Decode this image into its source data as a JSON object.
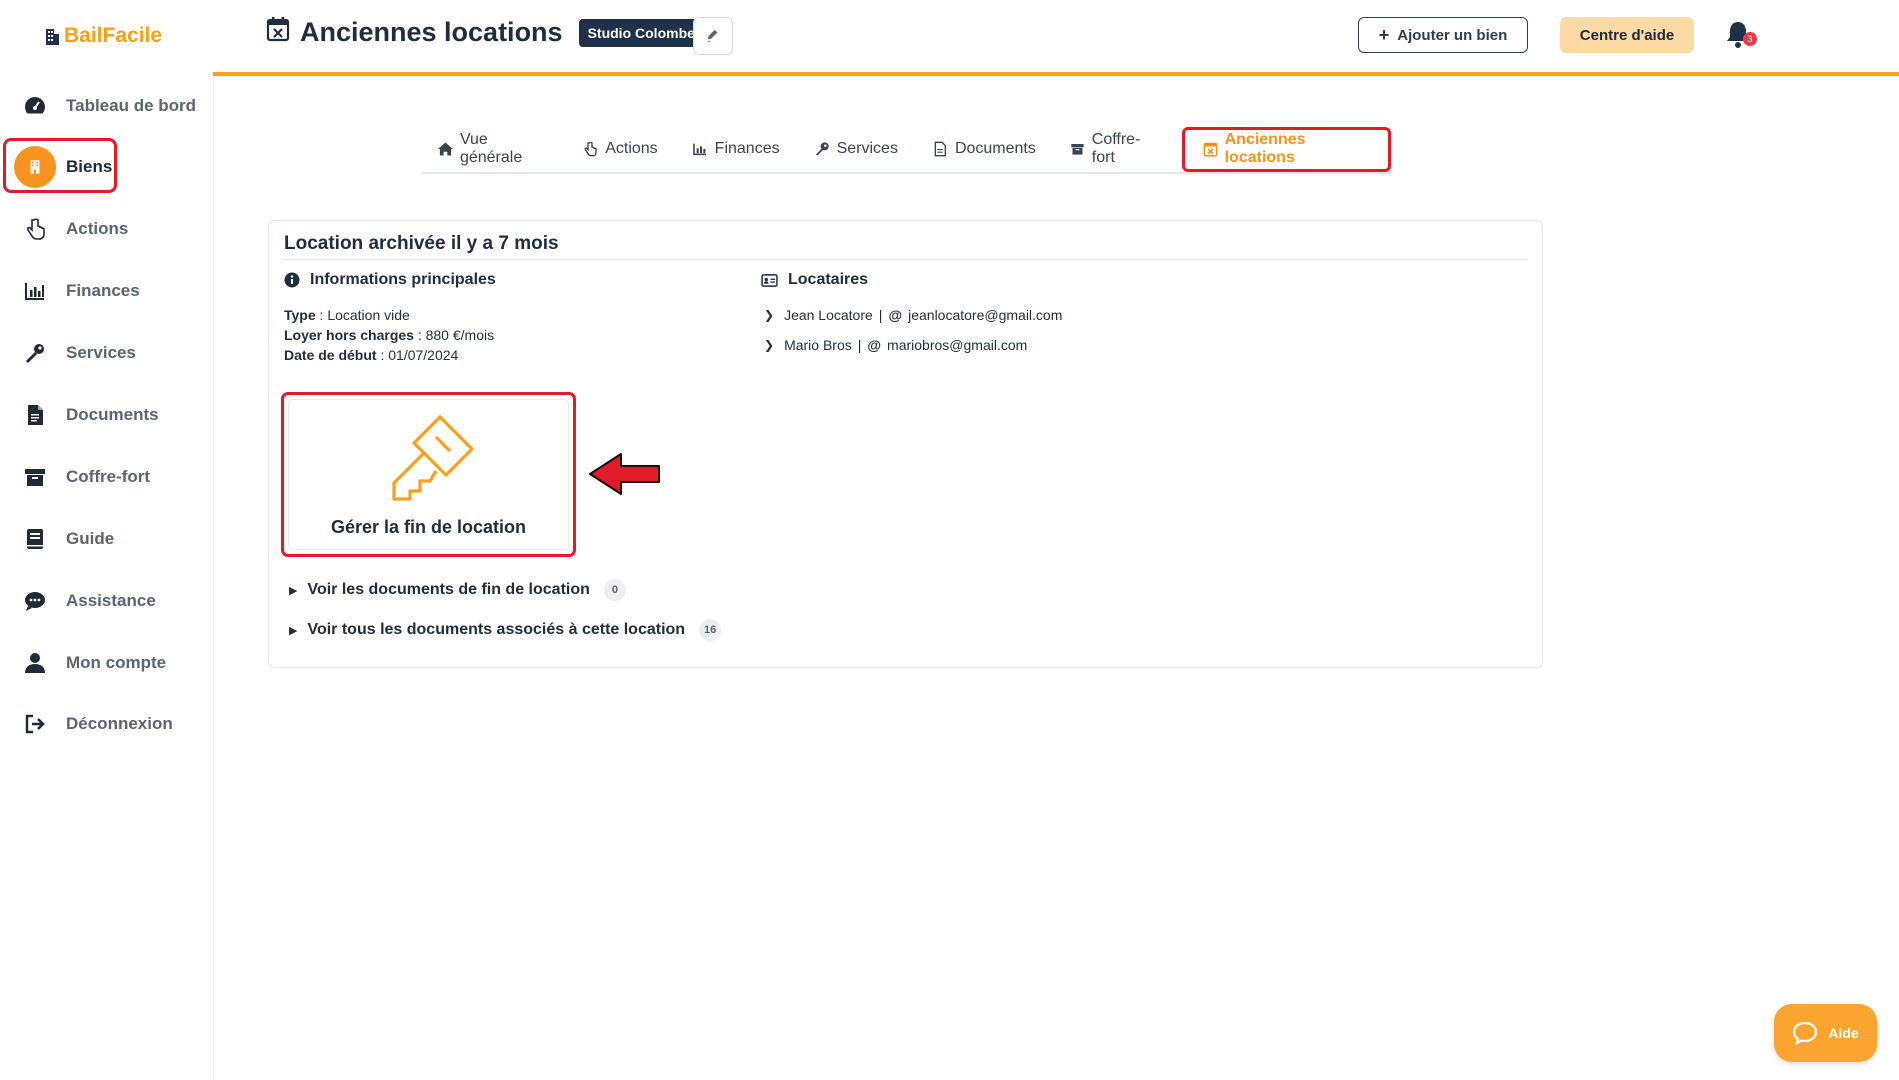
{
  "brand": {
    "name": "BailFacile",
    "color": "#f7a01c"
  },
  "sidebar": {
    "items": [
      {
        "label": "Tableau de bord",
        "icon": "dashboard-icon"
      },
      {
        "label": "Biens",
        "icon": "building-icon",
        "active": true
      },
      {
        "label": "Actions",
        "icon": "hand-pointer-icon"
      },
      {
        "label": "Finances",
        "icon": "bar-chart-icon"
      },
      {
        "label": "Services",
        "icon": "wrench-icon"
      },
      {
        "label": "Documents",
        "icon": "file-icon"
      },
      {
        "label": "Coffre-fort",
        "icon": "archive-icon"
      },
      {
        "label": "Guide",
        "icon": "book-icon"
      },
      {
        "label": "Assistance",
        "icon": "chat-icon"
      },
      {
        "label": "Mon compte",
        "icon": "user-icon"
      },
      {
        "label": "Déconnexion",
        "icon": "logout-icon"
      }
    ]
  },
  "header": {
    "title": "Anciennes locations",
    "property_badge": "Studio Colombes",
    "add_button": "Ajouter un bien",
    "help_button": "Centre d'aide",
    "notification_count": "3"
  },
  "tabs": [
    {
      "label": "Vue générale",
      "icon": "home-icon"
    },
    {
      "label": "Actions",
      "icon": "hand-pointer-icon"
    },
    {
      "label": "Finances",
      "icon": "bar-chart-icon"
    },
    {
      "label": "Services",
      "icon": "wrench-icon"
    },
    {
      "label": "Documents",
      "icon": "file-icon"
    },
    {
      "label": "Coffre-fort",
      "icon": "archive-icon"
    },
    {
      "label": "Anciennes locations",
      "icon": "calendar-x-icon",
      "active": true
    }
  ],
  "lease": {
    "title": "Location archivée il y a 7 mois",
    "info_title": "Informations principales",
    "type_label": "Type",
    "type_value": "Location vide",
    "rent_label": "Loyer hors charges",
    "rent_value": "880 €/mois",
    "start_label": "Date de début",
    "start_value": "01/07/2024",
    "tenants_title": "Locataires",
    "tenants": [
      {
        "name": "Jean Locatore",
        "email": "jeanlocatore@gmail.com"
      },
      {
        "name": "Mario Bros",
        "email": "mariobros@gmail.com"
      }
    ],
    "end_action": "Gérer la fin de location",
    "end_docs_label": "Voir les documents de fin de location",
    "end_docs_count": "0",
    "all_docs_label": "Voir tous les documents associés à cette location",
    "all_docs_count": "16"
  },
  "floating_help": {
    "label": "Aide"
  },
  "colors": {
    "accent": "#f7931e",
    "highlight": "#e01b2a",
    "navy": "#1f3149"
  }
}
